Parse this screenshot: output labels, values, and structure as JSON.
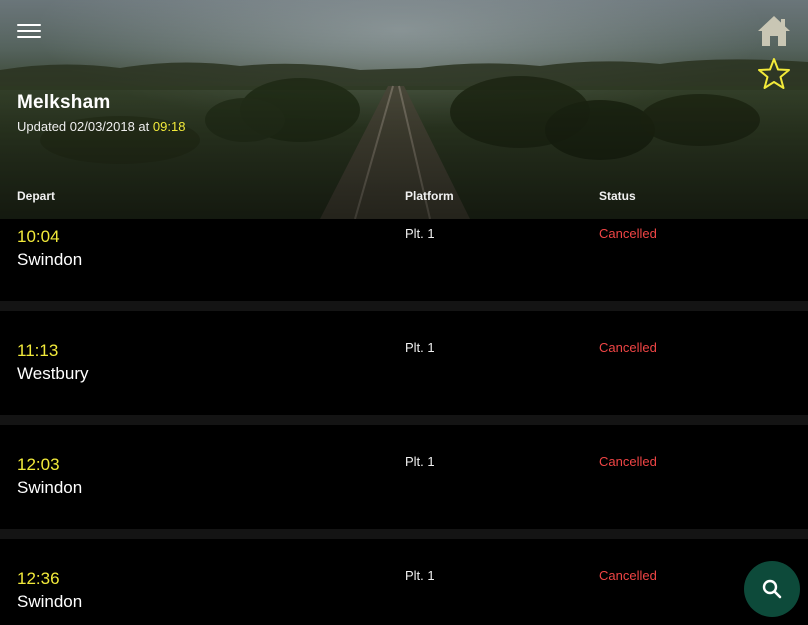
{
  "header": {
    "station": "Melksham",
    "updated_prefix": "Updated 02/03/2018 at ",
    "updated_time": "09:18"
  },
  "columns": {
    "depart": "Depart",
    "platform": "Platform",
    "status": "Status"
  },
  "departures": [
    {
      "time": "10:04",
      "destination": "Swindon",
      "platform": "Plt. 1",
      "status": "Cancelled"
    },
    {
      "time": "11:13",
      "destination": "Westbury",
      "platform": "Plt. 1",
      "status": "Cancelled"
    },
    {
      "time": "12:03",
      "destination": "Swindon",
      "platform": "Plt. 1",
      "status": "Cancelled"
    },
    {
      "time": "12:36",
      "destination": "Swindon",
      "platform": "Plt. 1",
      "status": "Cancelled"
    }
  ],
  "icons": {
    "menu": "menu-icon",
    "home": "home-icon",
    "favourite": "star-icon",
    "search": "search-icon"
  },
  "colors": {
    "accent_yellow": "#f2ea3a",
    "status_red": "#f04545",
    "fab_green": "#0d4a3a"
  }
}
